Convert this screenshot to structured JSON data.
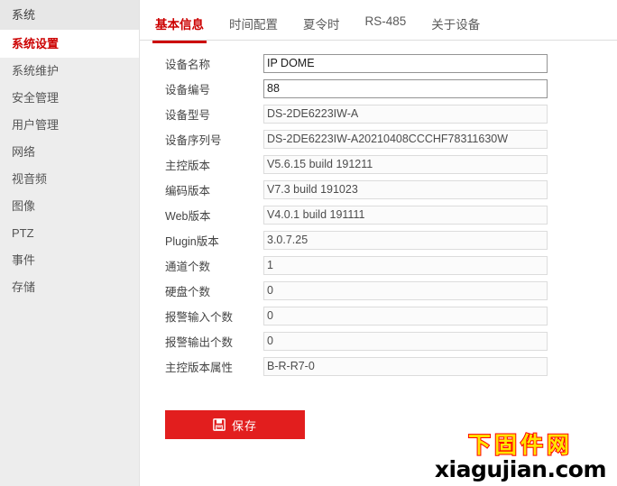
{
  "sidebar": {
    "group_title": "系统",
    "items": [
      {
        "label": "系统设置",
        "active": true
      },
      {
        "label": "系统维护",
        "active": false
      },
      {
        "label": "安全管理",
        "active": false
      },
      {
        "label": "用户管理",
        "active": false
      },
      {
        "label": "网络",
        "active": false
      },
      {
        "label": "视音频",
        "active": false
      },
      {
        "label": "图像",
        "active": false
      },
      {
        "label": "PTZ",
        "active": false
      },
      {
        "label": "事件",
        "active": false
      },
      {
        "label": "存储",
        "active": false
      }
    ]
  },
  "tabs": [
    {
      "label": "基本信息",
      "active": true
    },
    {
      "label": "时间配置",
      "active": false
    },
    {
      "label": "夏令时",
      "active": false
    },
    {
      "label": "RS-485",
      "active": false
    },
    {
      "label": "关于设备",
      "active": false
    }
  ],
  "form": {
    "rows": [
      {
        "label": "设备名称",
        "value": "IP DOME",
        "readonly": false
      },
      {
        "label": "设备编号",
        "value": "88",
        "readonly": false
      },
      {
        "label": "设备型号",
        "value": "DS-2DE6223IW-A",
        "readonly": true
      },
      {
        "label": "设备序列号",
        "value": "DS-2DE6223IW-A20210408CCCHF78311630W",
        "readonly": true
      },
      {
        "label": "主控版本",
        "value": "V5.6.15 build 191211",
        "readonly": true
      },
      {
        "label": "编码版本",
        "value": "V7.3 build 191023",
        "readonly": true
      },
      {
        "label": "Web版本",
        "value": "V4.0.1 build 191111",
        "readonly": true
      },
      {
        "label": "Plugin版本",
        "value": "3.0.7.25",
        "readonly": true
      },
      {
        "label": "通道个数",
        "value": "1",
        "readonly": true
      },
      {
        "label": "硬盘个数",
        "value": "0",
        "readonly": true
      },
      {
        "label": "报警输入个数",
        "value": "0",
        "readonly": true
      },
      {
        "label": "报警输出个数",
        "value": "0",
        "readonly": true
      },
      {
        "label": "主控版本属性",
        "value": "B-R-R7-0",
        "readonly": true
      }
    ]
  },
  "save": {
    "label": "保存",
    "icon": "save-floppy-icon"
  },
  "watermark": {
    "cn": "下固件网",
    "en": "xiagujian.com"
  },
  "colors": {
    "accent_red": "#cc0000",
    "button_red": "#e21e1e",
    "sidebar_bg": "#ededed",
    "watermark_fill": "#ffe400",
    "watermark_stroke": "#ff0000"
  }
}
